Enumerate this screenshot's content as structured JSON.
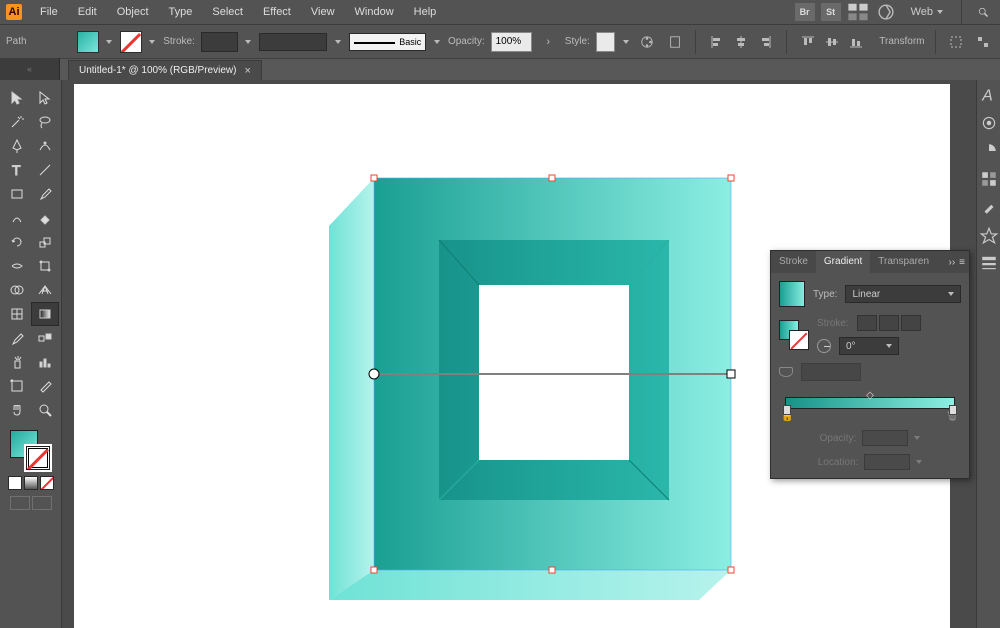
{
  "app": {
    "logo": "Ai"
  },
  "menu": {
    "items": [
      "File",
      "Edit",
      "Object",
      "Type",
      "Select",
      "Effect",
      "View",
      "Window",
      "Help"
    ]
  },
  "menubar_icons": {
    "br": "Br",
    "st": "St"
  },
  "workspace_switcher": {
    "label": "Web"
  },
  "options": {
    "path_label": "Path",
    "stroke_label": "Stroke:",
    "brush_label": "Basic",
    "opacity_label": "Opacity:",
    "opacity_value": "100%",
    "style_label": "Style:",
    "transform_label": "Transform"
  },
  "document_tab": {
    "title": "Untitled-1* @ 100% (RGB/Preview)",
    "close": "×"
  },
  "gradient_panel": {
    "tabs": {
      "stroke": "Stroke",
      "gradient": "Gradient",
      "transparency": "Transparen"
    },
    "type_label": "Type:",
    "type_value": "Linear",
    "stroke_row_label": "Stroke:",
    "angle_value": "0°",
    "opacity_label": "Opacity:",
    "location_label": "Location:",
    "expand": "››",
    "menu": "≡"
  },
  "colors": {
    "teal_dark": "#169287",
    "teal_light": "#8ceee3",
    "accent": "#f7931e"
  }
}
